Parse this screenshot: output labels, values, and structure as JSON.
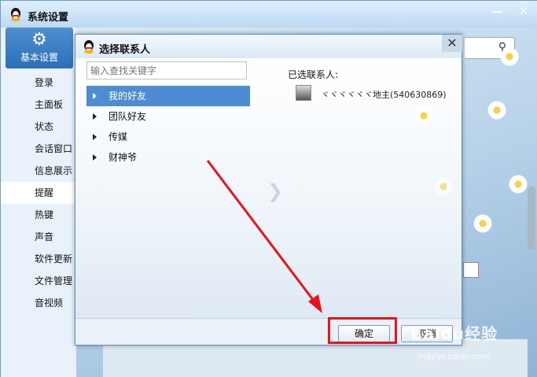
{
  "outer_window": {
    "title": "系统设置",
    "minimize_glyph": "—",
    "close_glyph": "✕"
  },
  "sidebar": {
    "header_icon": "gear-icon",
    "header_label": "基本设置",
    "items": [
      {
        "label": "登录"
      },
      {
        "label": "主面板"
      },
      {
        "label": "状态"
      },
      {
        "label": "会话窗口"
      },
      {
        "label": "信息展示"
      },
      {
        "label": "提醒"
      },
      {
        "label": "热键"
      },
      {
        "label": "声音"
      },
      {
        "label": "软件更新"
      },
      {
        "label": "文件管理"
      },
      {
        "label": "音视频"
      }
    ],
    "active_index": 5
  },
  "dialog": {
    "title": "选择联系人",
    "close_glyph": "✕",
    "search": {
      "placeholder": "输入查找关键字",
      "value": ""
    },
    "groups": [
      {
        "label": "我的好友",
        "selected": true
      },
      {
        "label": "团队好友",
        "selected": false
      },
      {
        "label": "传媒",
        "selected": false
      },
      {
        "label": "财神爷",
        "selected": false
      }
    ],
    "selected_label": "已选联系人:",
    "selected_contacts": [
      {
        "name": "ヾヾヾヾヾヾ地主(540630869)"
      }
    ],
    "ok_label": "确定",
    "cancel_label": "取消"
  },
  "watermark": {
    "text": "Baidu经验",
    "sub": "jingyan.baidu.com"
  },
  "colors": {
    "selection": "#4d8bd3",
    "highlight_red": "#e8141c",
    "sidebar_head": "#2a6fb8"
  }
}
